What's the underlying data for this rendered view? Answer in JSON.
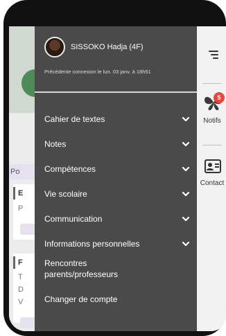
{
  "user": {
    "name": "SISSOKO Hadja (4F)",
    "last_login": "Précédente connexion le lun. 03 janv. à 18h51"
  },
  "menu": {
    "items": [
      {
        "label": "Cahier de textes",
        "expandable": true
      },
      {
        "label": "Notes",
        "expandable": true
      },
      {
        "label": "Compétences",
        "expandable": true
      },
      {
        "label": "Vie scolaire",
        "expandable": true
      },
      {
        "label": "Communication",
        "expandable": true
      },
      {
        "label": "Informations personnelles",
        "expandable": true
      },
      {
        "label": "Rencontres parents/professeurs",
        "expandable": false
      },
      {
        "label": "Changer de compte",
        "expandable": false
      }
    ]
  },
  "rail": {
    "notifs_label": "Notifs",
    "notifs_count": "5",
    "contact_label": "Contact"
  },
  "background": {
    "partial_text_1": "Po",
    "partial_text_2": "E",
    "partial_text_3": "P",
    "partial_text_4": "F",
    "partial_text_5": "T",
    "partial_text_6": "D",
    "partial_text_7": "V"
  },
  "colors": {
    "menu_bg": "#4a4a4a",
    "rail_bg": "#f2f2f2",
    "badge": "#e7463d"
  }
}
